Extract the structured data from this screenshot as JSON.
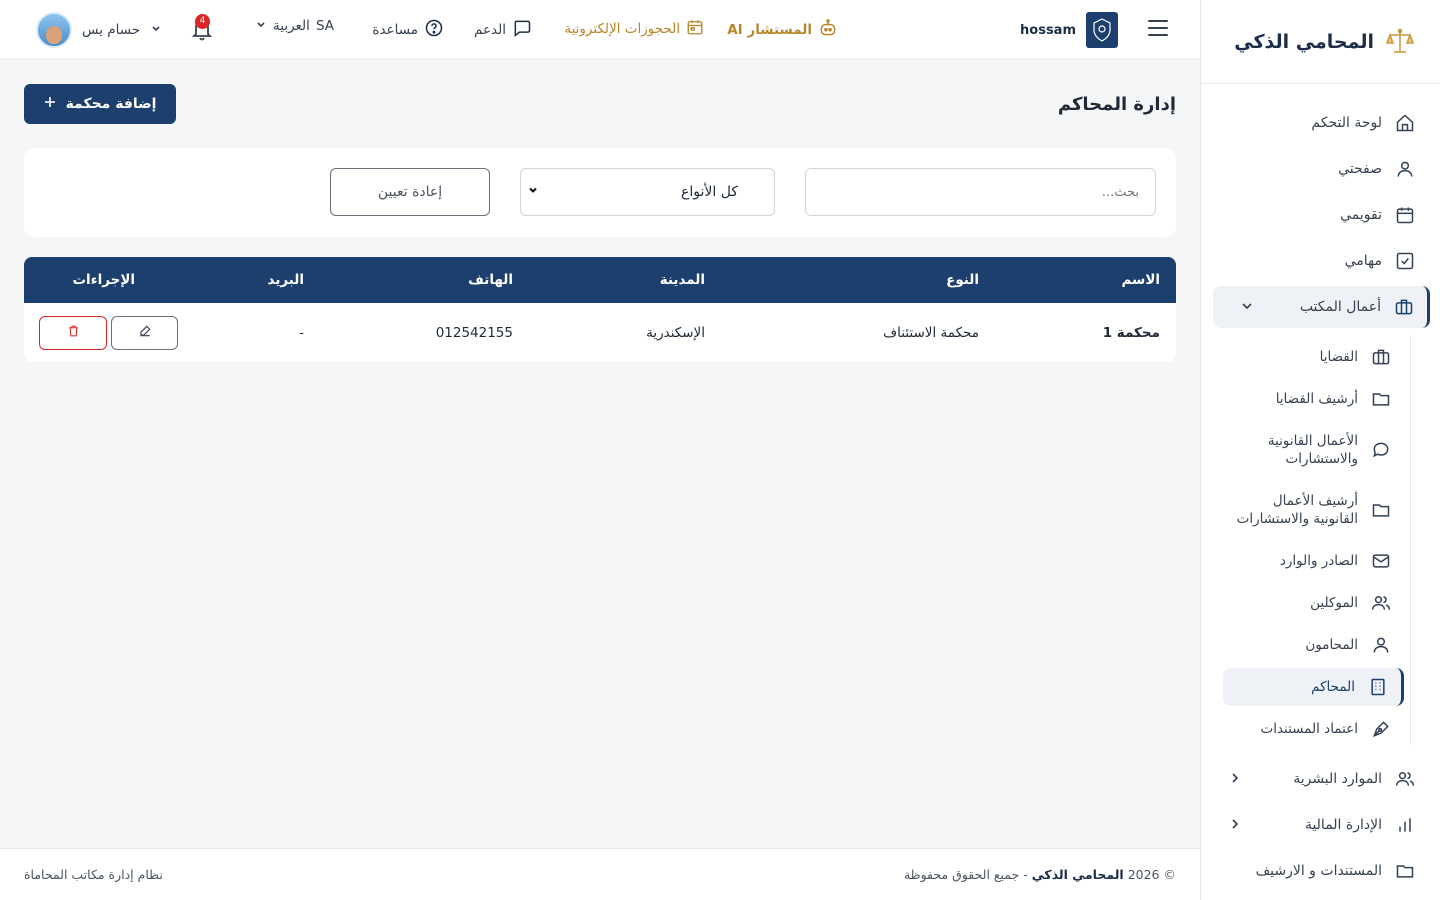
{
  "brand": {
    "title": "المحامي الذكي"
  },
  "header": {
    "firm_name": "hossam",
    "ai_label": "المستشار AI",
    "bookings_label": "الحجوزات الإلكترونية",
    "support_label": "الدعم",
    "help_label": "مساعدة",
    "lang_code": "SA",
    "lang_label": "العربية",
    "notif_count": "4",
    "user_name": "حسام يس"
  },
  "sidebar": {
    "items": [
      {
        "label": "لوحة التحكم",
        "icon": "home-icon"
      },
      {
        "label": "صفحتي",
        "icon": "user-icon"
      },
      {
        "label": "تقويمي",
        "icon": "calendar-icon"
      },
      {
        "label": "مهامي",
        "icon": "checkbox-icon"
      },
      {
        "label": "أعمال المكتب",
        "icon": "briefcase-icon"
      }
    ],
    "sub_items": [
      {
        "label": "القضايا",
        "icon": "briefcase-icon"
      },
      {
        "label": "أرشيف القضايا",
        "icon": "folder-icon"
      },
      {
        "label": "الأعمال القانونية والاستشارات",
        "icon": "chat-icon"
      },
      {
        "label": "أرشيف الأعمال القانونية والاستشارات",
        "icon": "folder-icon"
      },
      {
        "label": "الصادر والوارد",
        "icon": "mail-icon"
      },
      {
        "label": "الموكلين",
        "icon": "users-icon"
      },
      {
        "label": "المحامون",
        "icon": "user-icon"
      },
      {
        "label": "المحاكم",
        "icon": "building-icon"
      },
      {
        "label": "اعتماد المستندات",
        "icon": "pen-icon"
      }
    ],
    "bottom_items": [
      {
        "label": "الموارد البشرية",
        "icon": "users-icon"
      },
      {
        "label": "الإدارة المالية",
        "icon": "chart-icon"
      },
      {
        "label": "المستندات و الارشيف",
        "icon": "folder-icon"
      }
    ]
  },
  "main": {
    "title": "إدارة المحاكم",
    "add_button": "إضافة محكمة",
    "search_placeholder": "بحث...",
    "type_select": "كل الأنواع",
    "reset_button": "إعادة تعيين",
    "table": {
      "headers": [
        "الاسم",
        "النوع",
        "المدينة",
        "الهاتف",
        "البريد",
        "الإجراءات"
      ],
      "rows": [
        {
          "name": "محكمة 1",
          "type": "محكمة الاستئناف",
          "city": "الإسكندرية",
          "phone": "012542155",
          "email": "-"
        }
      ]
    }
  },
  "footer": {
    "copyright_prefix": "© 2026",
    "brand": "المحامي الذكي",
    "copyright_suffix": "- جميع الحقوق محفوظة",
    "system": "نظام إدارة مكاتب المحاماة"
  },
  "colors": {
    "primary": "#1c3f6e",
    "gold": "#b8862b",
    "danger": "#dc2626"
  }
}
